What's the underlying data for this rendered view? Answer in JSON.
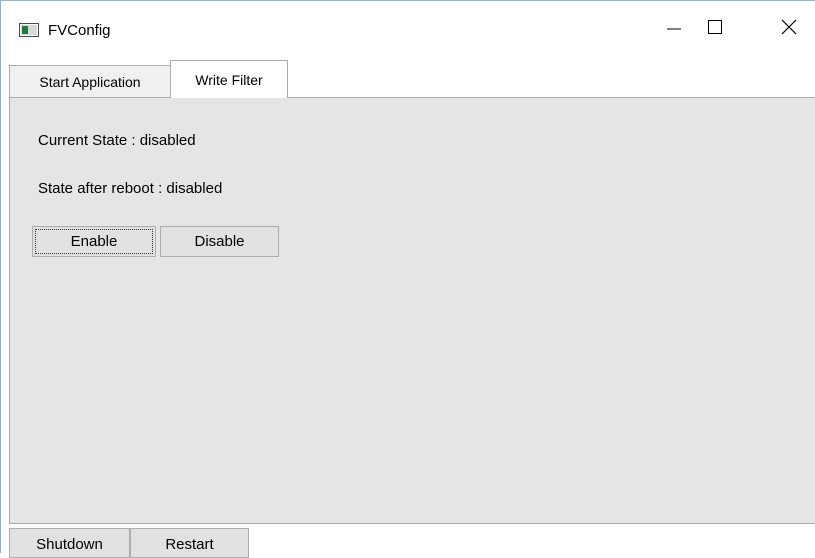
{
  "window": {
    "title": "FVConfig",
    "icon": "app-window-icon",
    "accent": "#8cb3d9"
  },
  "caption": {
    "minimize_icon": "minimize-icon",
    "maximize_icon": "maximize-icon",
    "close_icon": "close-icon"
  },
  "tabs": [
    {
      "label": "Start Application",
      "selected": false
    },
    {
      "label": "Write Filter",
      "selected": true
    }
  ],
  "write_filter": {
    "current_state": "Current State : disabled",
    "after_reboot": "State after reboot : disabled",
    "enable_label": "Enable",
    "disable_label": "Disable"
  },
  "footer": {
    "shutdown_label": "Shutdown",
    "restart_label": "Restart"
  },
  "colors": {
    "panel_bg": "#e5e5e5",
    "button_bg": "#e1e1e1",
    "border": "#acacac"
  }
}
